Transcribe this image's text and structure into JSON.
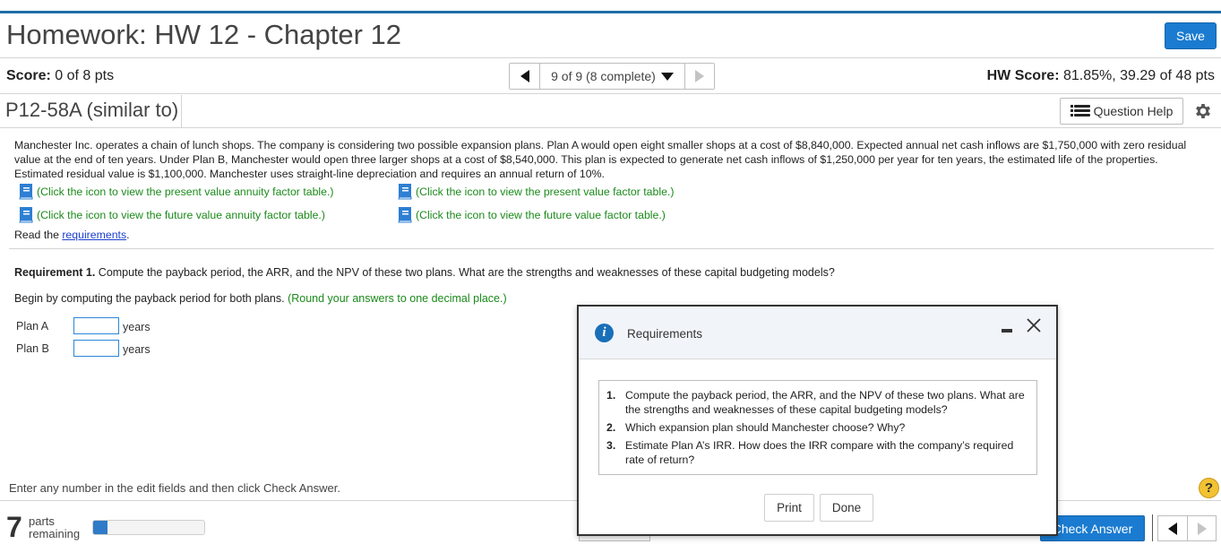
{
  "header": {
    "title": "Homework: HW 12 - Chapter 12",
    "save_label": "Save"
  },
  "score": {
    "label": "Score:",
    "value": "0 of 8 pts"
  },
  "hw_score": {
    "label": "HW Score:",
    "value": "81.85%, 39.29 of 48 pts"
  },
  "nav": {
    "position": "9 of 9 (8 complete)"
  },
  "problem": {
    "id": "P12-58A (similar to)",
    "question_help_label": "Question Help",
    "text": "Manchester Inc. operates a chain of lunch shops. The company is considering two possible expansion plans. Plan A would open eight smaller shops at a cost of $8,840,000. Expected annual net cash inflows are $1,750,000 with zero residual value at the end of ten years. Under Plan B, Manchester would open three larger shops at a cost of $8,540,000. This plan is expected to generate net cash inflows of $1,250,000 per year for ten years, the estimated life of the properties. Estimated residual value is $1,100,000. Manchester uses straight-line depreciation and requires an annual return of 10%.",
    "links": {
      "pv_annuity": "(Click the icon to view the present value annuity factor table.)",
      "pv_factor": "(Click the icon to view the present value factor table.)",
      "fv_annuity": "(Click the icon to view the future value annuity factor table.)",
      "fv_factor": "(Click the icon to view the future value factor table.)"
    },
    "read_prefix": "Read the ",
    "read_link": "requirements",
    "read_suffix": "."
  },
  "requirement1": {
    "label": "Requirement 1.",
    "text": " Compute the payback period, the ARR, and the NPV of these two plans. What are the strengths and weaknesses of these capital budgeting models?"
  },
  "begin": {
    "text": "Begin by computing the payback period for both plans. ",
    "hint": "(Round your answers to one decimal place.)"
  },
  "plans": [
    {
      "label": "Plan A",
      "value": "",
      "unit": "years"
    },
    {
      "label": "Plan B",
      "value": "",
      "unit": "years"
    }
  ],
  "footer": {
    "instruction": "Enter any number in the edit fields and then click Check Answer.",
    "help_glyph": "?",
    "parts_count": "7",
    "parts_line1": "parts",
    "parts_line2": "remaining",
    "progress_fraction": 0.125,
    "check_answer_label": "Check Answer"
  },
  "modal": {
    "title": "Requirements",
    "items": [
      {
        "num": "1.",
        "text": "Compute the payback period, the ARR, and the NPV of these two plans. What are the strengths and weaknesses of these capital budgeting models?"
      },
      {
        "num": "2.",
        "text": "Which expansion plan should Manchester choose? Why?"
      },
      {
        "num": "3.",
        "text": "Estimate Plan A’s IRR. How does the IRR compare with the company’s required rate of return?"
      }
    ],
    "print_label": "Print",
    "done_label": "Done"
  },
  "colors": {
    "accent": "#1a7bd0",
    "link_green": "#1b8a1b",
    "top_bar": "#1f6ea6",
    "help_yellow": "#f1c232"
  }
}
